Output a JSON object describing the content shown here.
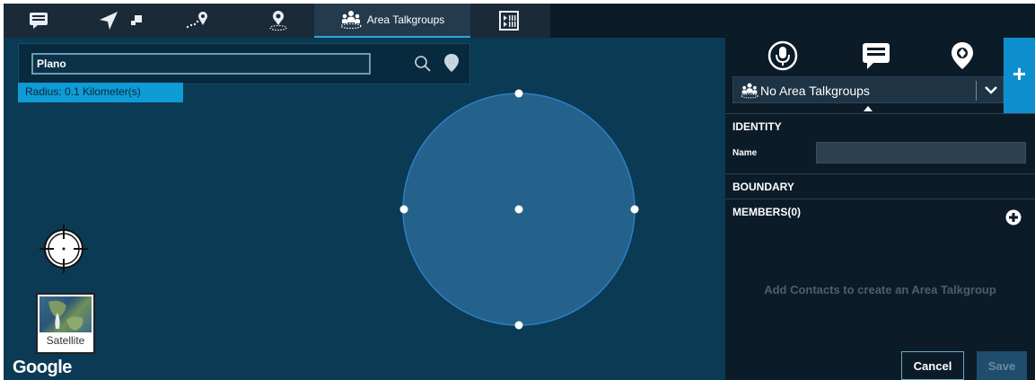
{
  "tabs": [
    {
      "icon": "message-icon",
      "label": ""
    },
    {
      "icon": "navigate-arrow-icon",
      "label": ""
    },
    {
      "icon": "route-pin-icon",
      "label": ""
    },
    {
      "icon": "location-pin-icon",
      "label": ""
    },
    {
      "icon": "area-talkgroups-icon",
      "label": "Area Talkgroups",
      "active": true
    },
    {
      "icon": "media-grid-icon",
      "label": ""
    }
  ],
  "map": {
    "search_value": "Plano",
    "radius_text": "Radius: 0.1 Kilometer(s)",
    "satellite_label": "Satellite",
    "provider_logo": "Google"
  },
  "panel": {
    "icons": [
      "microphone-icon",
      "chat-icon",
      "map-marker-icon"
    ],
    "add_label": "+",
    "dropdown_value": "No Area Talkgroups",
    "identity_header": "IDENTITY",
    "name_label": "Name",
    "name_value": "",
    "boundary_header": "BOUNDARY",
    "members_header": "MEMBERS(0)",
    "empty_message": "Add Contacts to create an Area Talkgroup",
    "cancel_label": "Cancel",
    "save_label": "Save"
  },
  "colors": {
    "map_background": "#0b3a55",
    "circle_fill": "#24618b",
    "accent": "#0e9bd6",
    "panel_background": "#0c1b28"
  }
}
